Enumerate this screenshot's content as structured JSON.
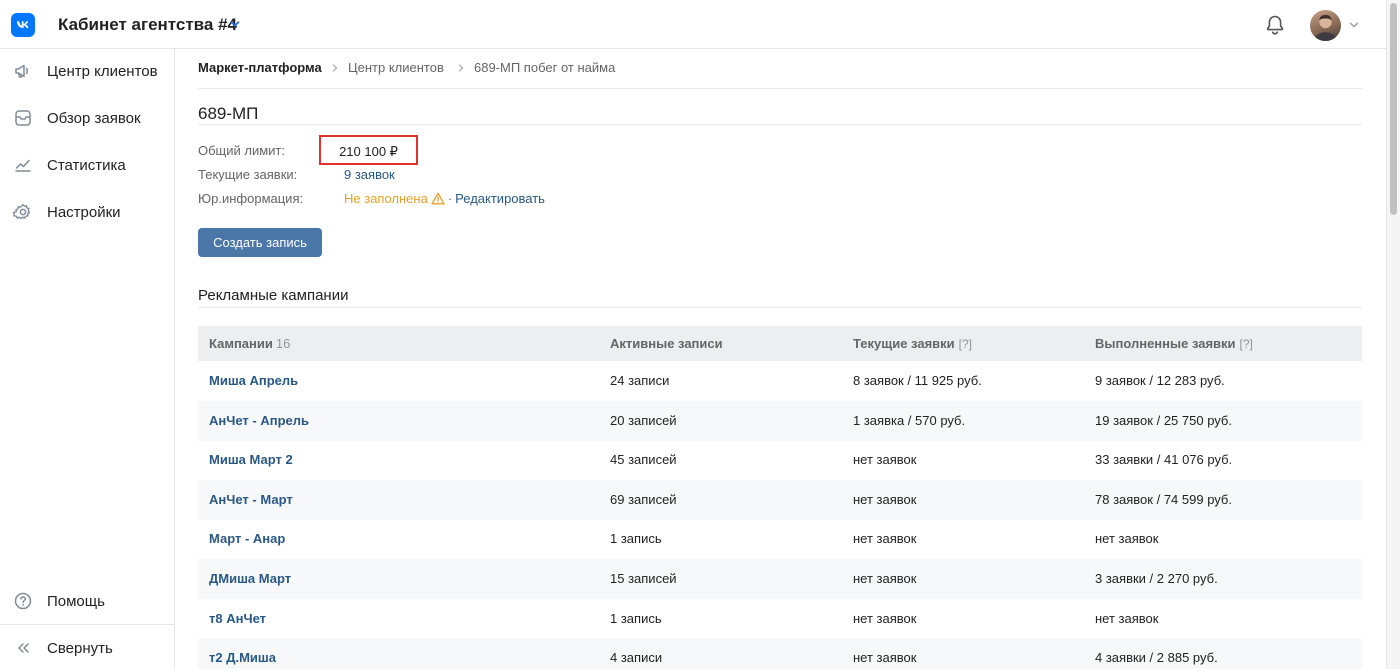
{
  "header": {
    "app_title": "Кабинет агентства #4",
    "logo_icon": "vk-logo-icon",
    "notifications_icon": "bell-icon",
    "accent_color": "#0077ff"
  },
  "sidebar": {
    "items": [
      {
        "label": "Центр клиентов",
        "icon": "megaphone-icon"
      },
      {
        "label": "Обзор заявок",
        "icon": "inbox-icon"
      },
      {
        "label": "Статистика",
        "icon": "chart-line-icon"
      },
      {
        "label": "Настройки",
        "icon": "gear-icon"
      }
    ],
    "help_label": "Помощь",
    "collapse_label": "Свернуть"
  },
  "breadcrumb": {
    "items": [
      "Маркет-платформа",
      "Центр клиентов",
      "689-МП побег от найма"
    ]
  },
  "client": {
    "title": "689-МП",
    "limit_label": "Общий лимит:",
    "limit_value": "210 100 ₽",
    "requests_label": "Текущие заявки:",
    "requests_value": "9 заявок",
    "legal_label": "Юр.информация:",
    "legal_status": "Не заполнена",
    "legal_separator": "·",
    "legal_edit": "Редактировать",
    "warning_color": "#e8a02a"
  },
  "create_button": {
    "label": "Создать запись",
    "color": "#4a76a8"
  },
  "campaigns": {
    "title": "Рекламные кампании",
    "headers": {
      "campaigns": "Кампании",
      "campaigns_count": "16",
      "active": "Активные записи",
      "current": "Текущие заявки",
      "current_hint": "[?]",
      "done": "Выполненные заявки",
      "done_hint": "[?]"
    },
    "rows": [
      {
        "name": "Миша Апрель",
        "active": "24 записи",
        "current": "8 заявок / 11 925 руб.",
        "done": "9 заявок / 12 283 руб."
      },
      {
        "name": "АнЧет - Апрель",
        "active": "20 записей",
        "current": "1 заявка / 570 руб.",
        "done": "19 заявок / 25 750 руб."
      },
      {
        "name": "Миша Март 2",
        "active": "45 записей",
        "current": "нет заявок",
        "done": "33 заявки / 41 076 руб."
      },
      {
        "name": "АнЧет - Март",
        "active": "69 записей",
        "current": "нет заявок",
        "done": "78 заявок / 74 599 руб."
      },
      {
        "name": "Март - Анар",
        "active": "1 запись",
        "current": "нет заявок",
        "done": "нет заявок"
      },
      {
        "name": "ДМиша Март",
        "active": "15 записей",
        "current": "нет заявок",
        "done": "3 заявки / 2 270 руб."
      },
      {
        "name": "т8 АнЧет",
        "active": "1 запись",
        "current": "нет заявок",
        "done": "нет заявок"
      },
      {
        "name": "т2 Д.Миша",
        "active": "4 записи",
        "current": "нет заявок",
        "done": "4 заявки / 2 885 руб."
      }
    ]
  }
}
